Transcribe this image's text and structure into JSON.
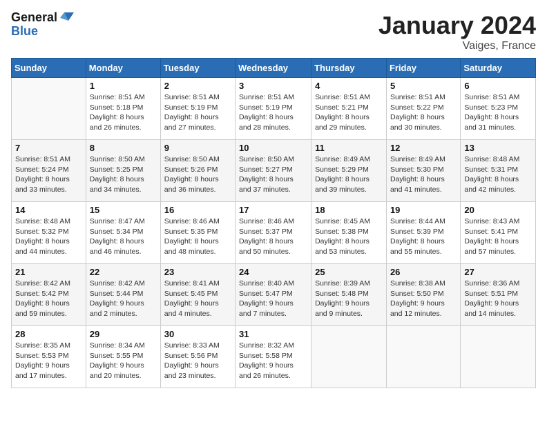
{
  "header": {
    "logo_line1": "General",
    "logo_line2": "Blue",
    "month_title": "January 2024",
    "location": "Vaiges, France"
  },
  "weekdays": [
    "Sunday",
    "Monday",
    "Tuesday",
    "Wednesday",
    "Thursday",
    "Friday",
    "Saturday"
  ],
  "weeks": [
    [
      {
        "day": "",
        "sunrise": "",
        "sunset": "",
        "daylight": ""
      },
      {
        "day": "1",
        "sunrise": "Sunrise: 8:51 AM",
        "sunset": "Sunset: 5:18 PM",
        "daylight": "Daylight: 8 hours and 26 minutes."
      },
      {
        "day": "2",
        "sunrise": "Sunrise: 8:51 AM",
        "sunset": "Sunset: 5:19 PM",
        "daylight": "Daylight: 8 hours and 27 minutes."
      },
      {
        "day": "3",
        "sunrise": "Sunrise: 8:51 AM",
        "sunset": "Sunset: 5:19 PM",
        "daylight": "Daylight: 8 hours and 28 minutes."
      },
      {
        "day": "4",
        "sunrise": "Sunrise: 8:51 AM",
        "sunset": "Sunset: 5:21 PM",
        "daylight": "Daylight: 8 hours and 29 minutes."
      },
      {
        "day": "5",
        "sunrise": "Sunrise: 8:51 AM",
        "sunset": "Sunset: 5:22 PM",
        "daylight": "Daylight: 8 hours and 30 minutes."
      },
      {
        "day": "6",
        "sunrise": "Sunrise: 8:51 AM",
        "sunset": "Sunset: 5:23 PM",
        "daylight": "Daylight: 8 hours and 31 minutes."
      }
    ],
    [
      {
        "day": "7",
        "sunrise": "Sunrise: 8:51 AM",
        "sunset": "Sunset: 5:24 PM",
        "daylight": "Daylight: 8 hours and 33 minutes."
      },
      {
        "day": "8",
        "sunrise": "Sunrise: 8:50 AM",
        "sunset": "Sunset: 5:25 PM",
        "daylight": "Daylight: 8 hours and 34 minutes."
      },
      {
        "day": "9",
        "sunrise": "Sunrise: 8:50 AM",
        "sunset": "Sunset: 5:26 PM",
        "daylight": "Daylight: 8 hours and 36 minutes."
      },
      {
        "day": "10",
        "sunrise": "Sunrise: 8:50 AM",
        "sunset": "Sunset: 5:27 PM",
        "daylight": "Daylight: 8 hours and 37 minutes."
      },
      {
        "day": "11",
        "sunrise": "Sunrise: 8:49 AM",
        "sunset": "Sunset: 5:29 PM",
        "daylight": "Daylight: 8 hours and 39 minutes."
      },
      {
        "day": "12",
        "sunrise": "Sunrise: 8:49 AM",
        "sunset": "Sunset: 5:30 PM",
        "daylight": "Daylight: 8 hours and 41 minutes."
      },
      {
        "day": "13",
        "sunrise": "Sunrise: 8:48 AM",
        "sunset": "Sunset: 5:31 PM",
        "daylight": "Daylight: 8 hours and 42 minutes."
      }
    ],
    [
      {
        "day": "14",
        "sunrise": "Sunrise: 8:48 AM",
        "sunset": "Sunset: 5:32 PM",
        "daylight": "Daylight: 8 hours and 44 minutes."
      },
      {
        "day": "15",
        "sunrise": "Sunrise: 8:47 AM",
        "sunset": "Sunset: 5:34 PM",
        "daylight": "Daylight: 8 hours and 46 minutes."
      },
      {
        "day": "16",
        "sunrise": "Sunrise: 8:46 AM",
        "sunset": "Sunset: 5:35 PM",
        "daylight": "Daylight: 8 hours and 48 minutes."
      },
      {
        "day": "17",
        "sunrise": "Sunrise: 8:46 AM",
        "sunset": "Sunset: 5:37 PM",
        "daylight": "Daylight: 8 hours and 50 minutes."
      },
      {
        "day": "18",
        "sunrise": "Sunrise: 8:45 AM",
        "sunset": "Sunset: 5:38 PM",
        "daylight": "Daylight: 8 hours and 53 minutes."
      },
      {
        "day": "19",
        "sunrise": "Sunrise: 8:44 AM",
        "sunset": "Sunset: 5:39 PM",
        "daylight": "Daylight: 8 hours and 55 minutes."
      },
      {
        "day": "20",
        "sunrise": "Sunrise: 8:43 AM",
        "sunset": "Sunset: 5:41 PM",
        "daylight": "Daylight: 8 hours and 57 minutes."
      }
    ],
    [
      {
        "day": "21",
        "sunrise": "Sunrise: 8:42 AM",
        "sunset": "Sunset: 5:42 PM",
        "daylight": "Daylight: 8 hours and 59 minutes."
      },
      {
        "day": "22",
        "sunrise": "Sunrise: 8:42 AM",
        "sunset": "Sunset: 5:44 PM",
        "daylight": "Daylight: 9 hours and 2 minutes."
      },
      {
        "day": "23",
        "sunrise": "Sunrise: 8:41 AM",
        "sunset": "Sunset: 5:45 PM",
        "daylight": "Daylight: 9 hours and 4 minutes."
      },
      {
        "day": "24",
        "sunrise": "Sunrise: 8:40 AM",
        "sunset": "Sunset: 5:47 PM",
        "daylight": "Daylight: 9 hours and 7 minutes."
      },
      {
        "day": "25",
        "sunrise": "Sunrise: 8:39 AM",
        "sunset": "Sunset: 5:48 PM",
        "daylight": "Daylight: 9 hours and 9 minutes."
      },
      {
        "day": "26",
        "sunrise": "Sunrise: 8:38 AM",
        "sunset": "Sunset: 5:50 PM",
        "daylight": "Daylight: 9 hours and 12 minutes."
      },
      {
        "day": "27",
        "sunrise": "Sunrise: 8:36 AM",
        "sunset": "Sunset: 5:51 PM",
        "daylight": "Daylight: 9 hours and 14 minutes."
      }
    ],
    [
      {
        "day": "28",
        "sunrise": "Sunrise: 8:35 AM",
        "sunset": "Sunset: 5:53 PM",
        "daylight": "Daylight: 9 hours and 17 minutes."
      },
      {
        "day": "29",
        "sunrise": "Sunrise: 8:34 AM",
        "sunset": "Sunset: 5:55 PM",
        "daylight": "Daylight: 9 hours and 20 minutes."
      },
      {
        "day": "30",
        "sunrise": "Sunrise: 8:33 AM",
        "sunset": "Sunset: 5:56 PM",
        "daylight": "Daylight: 9 hours and 23 minutes."
      },
      {
        "day": "31",
        "sunrise": "Sunrise: 8:32 AM",
        "sunset": "Sunset: 5:58 PM",
        "daylight": "Daylight: 9 hours and 26 minutes."
      },
      {
        "day": "",
        "sunrise": "",
        "sunset": "",
        "daylight": ""
      },
      {
        "day": "",
        "sunrise": "",
        "sunset": "",
        "daylight": ""
      },
      {
        "day": "",
        "sunrise": "",
        "sunset": "",
        "daylight": ""
      }
    ]
  ]
}
